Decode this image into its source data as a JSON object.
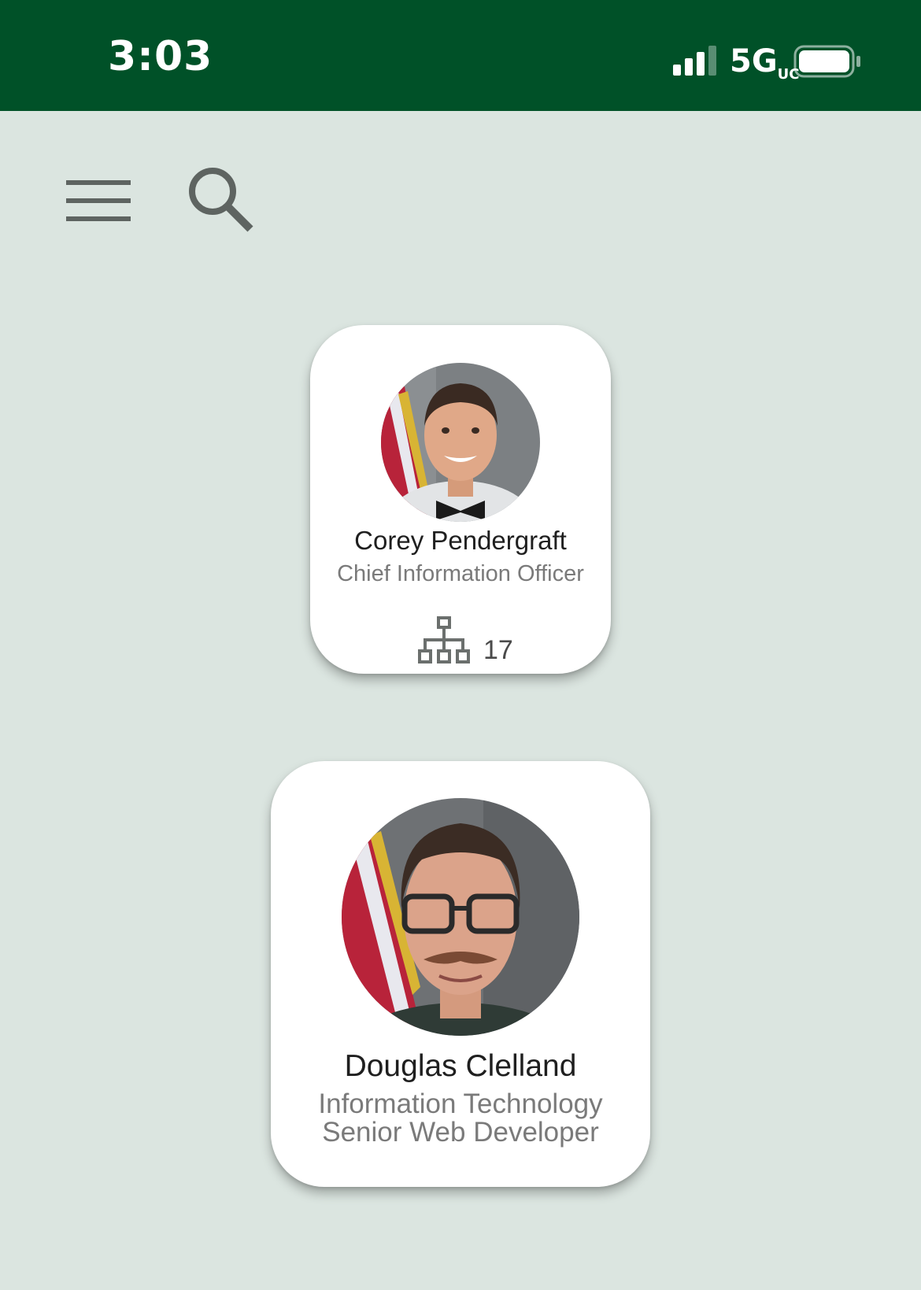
{
  "status_bar": {
    "time": "3:03",
    "network": "5G",
    "network_suffix": "UC",
    "signal_icon": "signal-bars-icon",
    "battery_icon": "battery-full-icon"
  },
  "toolbar": {
    "menu_icon": "hamburger-menu-icon",
    "search_icon": "search-icon"
  },
  "people": [
    {
      "name": "Corey Pendergraft",
      "title": "Chief Information Officer",
      "direct_reports_icon": "org-chart-icon",
      "direct_reports_count": "17"
    },
    {
      "name": "Douglas Clelland",
      "department": "Information Technology",
      "title": "Senior Web Developer"
    }
  ],
  "colors": {
    "status_bar_bg": "#005128",
    "page_bg": "#dbe5e0",
    "card_bg": "#ffffff",
    "icon_gray": "#5e6461",
    "name_text": "#1f1f1f",
    "role_text": "#7a7a7a"
  }
}
